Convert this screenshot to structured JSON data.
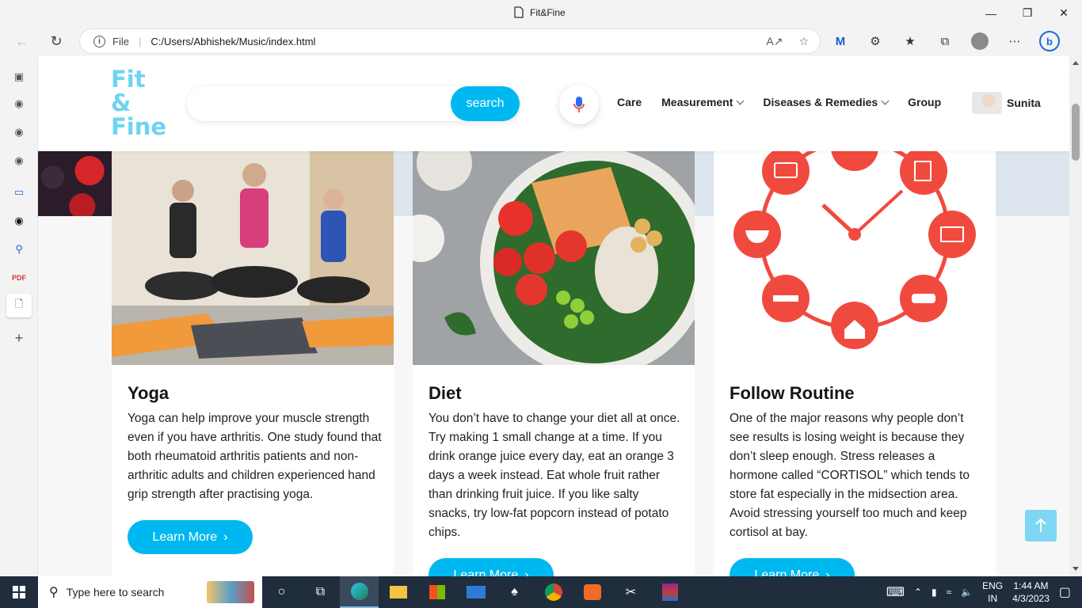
{
  "browser": {
    "tab_title": "Fit&Fine",
    "file_label": "File",
    "url": "C:/Users/Abhishek/Music/index.html"
  },
  "site": {
    "logo_line1": "Fit",
    "logo_line2": "&",
    "logo_line3": "Fine",
    "search_button": "search",
    "search_placeholder": "",
    "nav": [
      "Care",
      "Measurement",
      "Diseases & Remedies",
      "Group"
    ],
    "user_name": "Sunita"
  },
  "cards": [
    {
      "title": "Yoga",
      "text": "Yoga can help improve your muscle strength even if you have arthritis. One study found that both rheumatoid arthritis patients and non-arthritic adults and children experienced hand grip strength after practising yoga.",
      "button": "Learn More"
    },
    {
      "title": "Diet",
      "text": "You don’t have to change your diet all at once. Try making 1 small change at a time. If you drink orange juice every day, eat an orange 3 days a week instead. Eat whole fruit rather than drinking fruit juice. If you like salty snacks, try low-fat popcorn instead of potato chips.",
      "button": "Learn More"
    },
    {
      "title": "Follow Routine",
      "text": "One of the major reasons why people don’t see results is losing weight is because they don’t sleep enough. Stress releases a hormone called “CORTISOL” which tends to store fat especially in the midsection area. Avoid stressing yourself too much and keep cortisol at bay.",
      "button": "Learn More"
    }
  ],
  "taskbar": {
    "search_placeholder": "Type here to search",
    "lang1": "ENG",
    "lang2": "IN",
    "time": "1:44 AM",
    "date": "4/3/2023"
  },
  "colors": {
    "accent": "#00b8f0",
    "logo": "#6dd3f2",
    "routine_red": "#f04a3f"
  }
}
